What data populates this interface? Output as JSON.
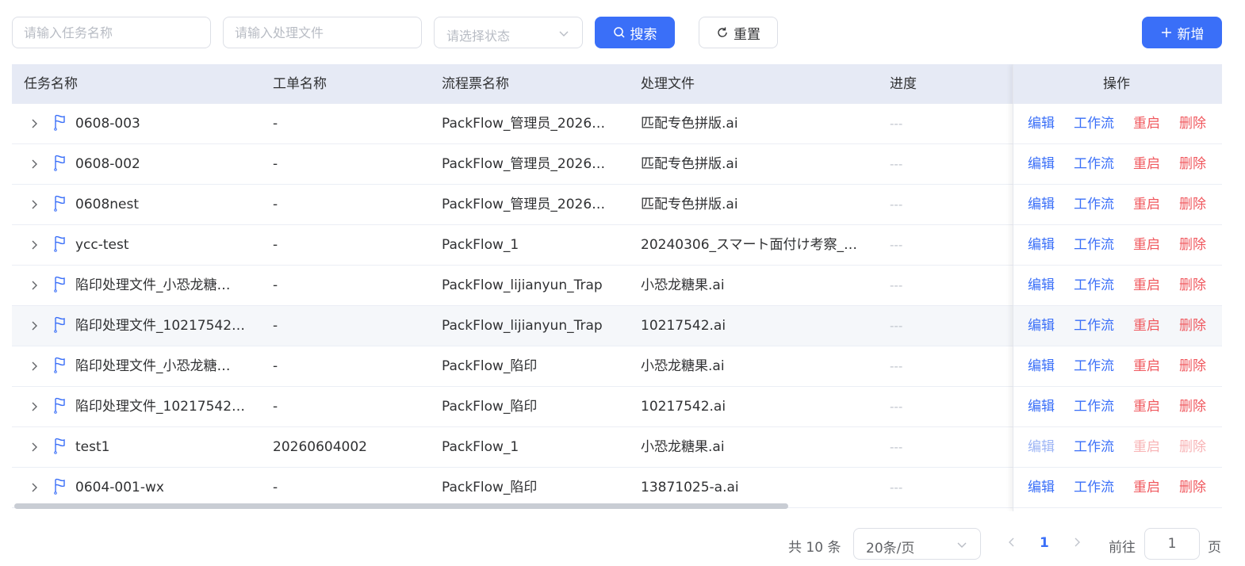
{
  "filters": {
    "task_placeholder": "请输入任务名称",
    "file_placeholder": "请输入处理文件",
    "status_placeholder": "请选择状态",
    "search_label": "搜索",
    "reset_label": "重置",
    "add_label": "新增"
  },
  "table": {
    "headers": {
      "task": "任务名称",
      "order": "工单名称",
      "ticket": "流程票名称",
      "file": "处理文件",
      "progress": "进度",
      "ops": "操作"
    },
    "op_labels": {
      "edit": "编辑",
      "workflow": "工作流",
      "restart": "重启",
      "delete": "删除"
    },
    "rows": [
      {
        "task": "0608-003",
        "order": "-",
        "ticket": "PackFlow_管理员_2026…",
        "file": "匹配专色拼版.ai",
        "progress": "---",
        "disabled": false
      },
      {
        "task": "0608-002",
        "order": "-",
        "ticket": "PackFlow_管理员_2026…",
        "file": "匹配专色拼版.ai",
        "progress": "---",
        "disabled": false
      },
      {
        "task": "0608nest",
        "order": "-",
        "ticket": "PackFlow_管理员_2026…",
        "file": "匹配专色拼版.ai",
        "progress": "---",
        "disabled": false
      },
      {
        "task": "ycc-test",
        "order": "-",
        "ticket": "PackFlow_1",
        "file": "20240306_スマート面付け考察_…",
        "progress": "---",
        "disabled": false
      },
      {
        "task": "陷印处理文件_小恐龙糖…",
        "order": "-",
        "ticket": "PackFlow_lijianyun_Trap",
        "file": "小恐龙糖果.ai",
        "progress": "---",
        "disabled": false
      },
      {
        "task": "陷印处理文件_10217542…",
        "order": "-",
        "ticket": "PackFlow_lijianyun_Trap",
        "file": "10217542.ai",
        "progress": "---",
        "disabled": false
      },
      {
        "task": "陷印处理文件_小恐龙糖…",
        "order": "-",
        "ticket": "PackFlow_陷印",
        "file": "小恐龙糖果.ai",
        "progress": "---",
        "disabled": false
      },
      {
        "task": "陷印处理文件_10217542…",
        "order": "-",
        "ticket": "PackFlow_陷印",
        "file": "10217542.ai",
        "progress": "---",
        "disabled": false
      },
      {
        "task": "test1",
        "order": "20260604002",
        "ticket": "PackFlow_1",
        "file": "小恐龙糖果.ai",
        "progress": "---",
        "disabled": true
      },
      {
        "task": "0604-001-wx",
        "order": "-",
        "ticket": "PackFlow_陷印",
        "file": "13871025-a.ai",
        "progress": "---",
        "disabled": false
      }
    ]
  },
  "pagination": {
    "total_text": "共 10 条",
    "page_size": "20条/页",
    "current_page": "1",
    "goto_prefix": "前往",
    "goto_value": "1",
    "goto_suffix": "页"
  },
  "colors": {
    "primary": "#3a6ff8",
    "danger": "#f0585e",
    "header_bg": "#e6eaf5"
  },
  "icons": {
    "search": "search-icon",
    "reset": "refresh-icon",
    "add": "plus-icon",
    "expand": "chevron-right-icon",
    "flag": "flag-icon",
    "dropdown": "chevron-down-icon"
  }
}
